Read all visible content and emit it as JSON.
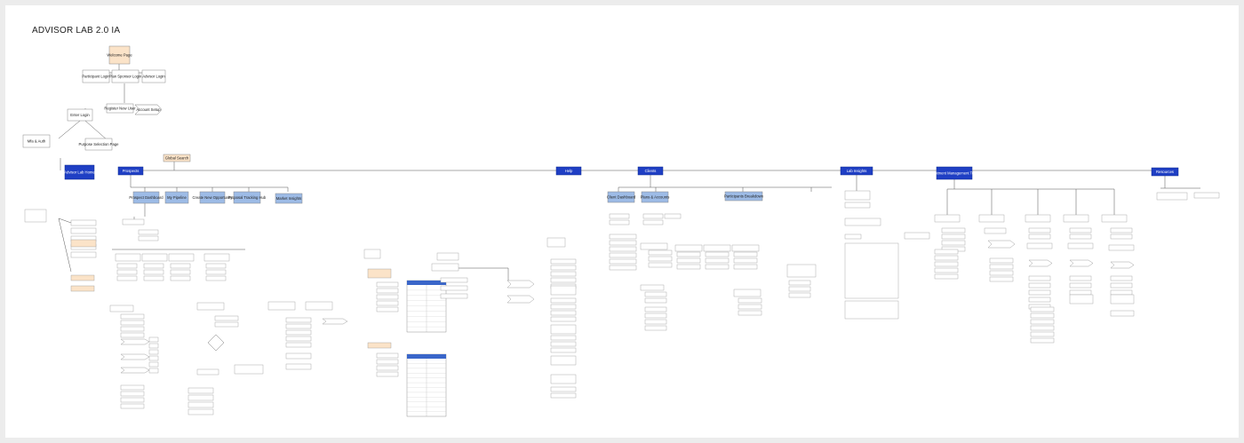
{
  "title": "ADVISOR LAB 2.0 IA",
  "colors": {
    "navy": "#1f3fc4",
    "lightblue": "#9dbbe6",
    "paleblue": "#dfe9f6",
    "peach": "#fbe3c8",
    "white": "#ffffff",
    "line": "#555555"
  },
  "nodes": [
    {
      "id": "welcome",
      "label": "Welcome Page",
      "style": "peach"
    },
    {
      "id": "login_participant",
      "label": "Participant Login",
      "style": "white"
    },
    {
      "id": "login_plan_sponsor",
      "label": "Plan Sponsor Login",
      "style": "white"
    },
    {
      "id": "login_advisor",
      "label": "Advisor Login",
      "style": "white"
    },
    {
      "id": "enter_login",
      "label": "Enter Login",
      "style": "white"
    },
    {
      "id": "register",
      "label": "Register New User",
      "style": "white"
    },
    {
      "id": "account_setup",
      "label": "Account Setup",
      "style": "chevron"
    },
    {
      "id": "mfa",
      "label": "Mfa & Auth",
      "style": "white"
    },
    {
      "id": "purpose",
      "label": "Purpose Selection Page",
      "style": "white"
    },
    {
      "id": "global_search",
      "label": "Global Search",
      "style": "peach"
    },
    {
      "id": "home",
      "label": "Advisor Lab Home",
      "style": "navy"
    },
    {
      "id": "nav_prospects",
      "label": "Prospects",
      "style": "navy"
    },
    {
      "id": "nav_help",
      "label": "Help",
      "style": "navy"
    },
    {
      "id": "nav_clients",
      "label": "Clients",
      "style": "navy"
    },
    {
      "id": "nav_insights",
      "label": "Lab Insights",
      "style": "navy"
    },
    {
      "id": "nav_investment",
      "label": "Investment Management Toolkit",
      "style": "navy"
    },
    {
      "id": "nav_resources",
      "label": "Resources",
      "style": "navy"
    },
    {
      "id": "p1",
      "label": "Prospect Dashboard",
      "style": "lightblue"
    },
    {
      "id": "p2",
      "label": "My Pipeline",
      "style": "lightblue"
    },
    {
      "id": "p3",
      "label": "Create New Opportunity",
      "style": "lightblue"
    },
    {
      "id": "p4",
      "label": "Proposal Tracking Hub",
      "style": "lightblue"
    },
    {
      "id": "p5",
      "label": "Market Insights",
      "style": "lightblue"
    },
    {
      "id": "c1",
      "label": "Client Dashboard",
      "style": "lightblue"
    },
    {
      "id": "c2",
      "label": "Plans & Accounts",
      "style": "lightblue"
    },
    {
      "id": "c3",
      "label": "Participants Breakdown",
      "style": "lightblue"
    }
  ]
}
